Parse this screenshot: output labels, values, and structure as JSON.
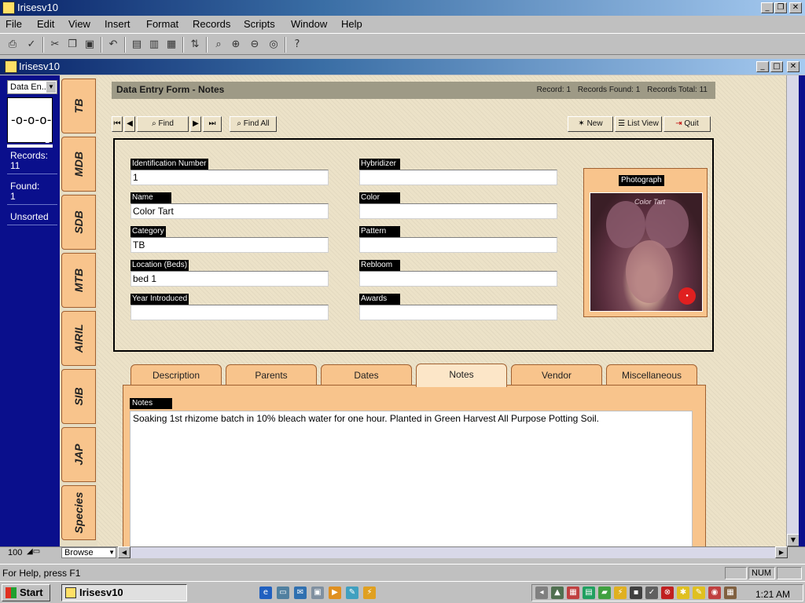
{
  "app": {
    "title": "Irisesv10"
  },
  "menu": [
    "File",
    "Edit",
    "View",
    "Insert",
    "Format",
    "Records",
    "Scripts",
    "Window",
    "Help"
  ],
  "doc_window": {
    "title": "Irisesv10"
  },
  "status_area": {
    "layout": "Data En...",
    "book_page": "1",
    "records_label": "Records:",
    "records_value": "11",
    "found_label": "Found:",
    "found_value": "1",
    "sort_state": "Unsorted"
  },
  "side_tabs": [
    "TB",
    "MDB",
    "SDB",
    "MTB",
    "AIRIL",
    "SIB",
    "JAP",
    "Species"
  ],
  "form": {
    "title": "Data Entry Form - Notes",
    "record": "Record: 1",
    "found": "Records Found: 1",
    "total": "Records Total: 11",
    "buttons": {
      "find": "Find",
      "find_all": "Find All",
      "new": "New",
      "list_view": "List View",
      "quit": "Quit"
    },
    "fields": {
      "identification_number": {
        "label": "Identification Number",
        "value": "1"
      },
      "name": {
        "label": "Name",
        "value": "Color Tart"
      },
      "category": {
        "label": "Category",
        "value": "TB"
      },
      "location": {
        "label": "Location (Beds)",
        "value": "bed 1"
      },
      "year_introduced": {
        "label": "Year Introduced",
        "value": ""
      },
      "hybridizer": {
        "label": "Hybridizer",
        "value": ""
      },
      "color": {
        "label": "Color",
        "value": ""
      },
      "pattern": {
        "label": "Pattern",
        "value": ""
      },
      "rebloom": {
        "label": "Rebloom",
        "value": ""
      },
      "awards": {
        "label": "Awards",
        "value": ""
      }
    },
    "photo_label": "Photograph",
    "photo_caption": "Color Tart"
  },
  "tabs": [
    "Description",
    "Parents",
    "Dates",
    "Notes",
    "Vendor",
    "Miscellaneous"
  ],
  "active_tab": "Notes",
  "notes": {
    "label": "Notes",
    "text": "Soaking 1st rhizome batch in 10% bleach water for one hour.  Planted in Green Harvest All Purpose Potting Soil."
  },
  "bottom_bar": {
    "zoom": "100",
    "mode": "Browse"
  },
  "statusbar": {
    "help": "For Help, press F1",
    "num": "NUM"
  },
  "taskbar": {
    "start": "Start",
    "task": "Irisesv10",
    "clock": "1:21 AM"
  },
  "colors": {
    "title_blue": "#0a246a",
    "tab_orange": "#f8c48c",
    "status_blue": "#0a0f8c",
    "content_bg": "#ece2c8"
  }
}
